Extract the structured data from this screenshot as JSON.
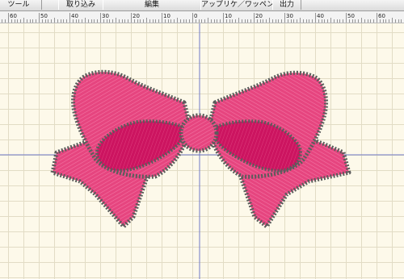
{
  "toolbar": {
    "tabs": [
      {
        "id": "tool",
        "label": "ツール"
      },
      {
        "id": "import",
        "label": "取り込み"
      },
      {
        "id": "edit",
        "label": "編集"
      },
      {
        "id": "applique",
        "label": "アップリケ／ワッペン"
      },
      {
        "id": "output",
        "label": "出力"
      }
    ]
  },
  "ruler": {
    "labels": [
      "60",
      "50",
      "40",
      "30",
      "20",
      "10",
      "0",
      "10",
      "20",
      "30",
      "40",
      "50",
      "60"
    ]
  },
  "colors": {
    "canvas_bg": "#fdf9ea",
    "grid": "#e2dcc5",
    "guide": "#6e79c8",
    "bow_pink": "#e6457f",
    "bow_inner": "#cc1460",
    "outline": "#5c5c5c"
  },
  "design": {
    "motif": "bow-embroidery"
  }
}
